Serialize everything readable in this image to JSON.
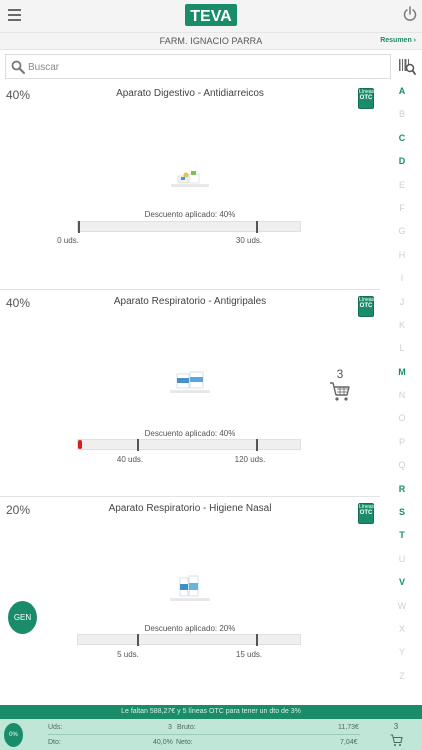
{
  "header": {
    "logo_text": "TEVA",
    "pharmacy_name": "FARM. IGNACIO PARRA",
    "summary_link": "Resumen ›"
  },
  "search": {
    "placeholder": "Buscar"
  },
  "alphabet": [
    {
      "letter": "A",
      "active": true
    },
    {
      "letter": "B",
      "active": false
    },
    {
      "letter": "C",
      "active": true
    },
    {
      "letter": "D",
      "active": true
    },
    {
      "letter": "E",
      "active": false
    },
    {
      "letter": "F",
      "active": false
    },
    {
      "letter": "G",
      "active": false
    },
    {
      "letter": "H",
      "active": false
    },
    {
      "letter": "I",
      "active": false
    },
    {
      "letter": "J",
      "active": false
    },
    {
      "letter": "K",
      "active": false
    },
    {
      "letter": "L",
      "active": false
    },
    {
      "letter": "M",
      "active": true
    },
    {
      "letter": "N",
      "active": false
    },
    {
      "letter": "O",
      "active": false
    },
    {
      "letter": "P",
      "active": false
    },
    {
      "letter": "Q",
      "active": false
    },
    {
      "letter": "R",
      "active": true
    },
    {
      "letter": "S",
      "active": true
    },
    {
      "letter": "T",
      "active": true
    },
    {
      "letter": "U",
      "active": false
    },
    {
      "letter": "V",
      "active": true
    },
    {
      "letter": "W",
      "active": false
    },
    {
      "letter": "X",
      "active": false
    },
    {
      "letter": "Y",
      "active": false
    },
    {
      "letter": "Z",
      "active": false
    }
  ],
  "cards": [
    {
      "discount_pct": "40%",
      "title": "Aparato Digestivo - Antidiarreicos",
      "badge_line1": "Líneas",
      "badge_line2": "OTC",
      "discount_applied": "Descuento aplicado: 40%",
      "tier1_label": "0 uds.",
      "tier2_label": "30 uds."
    },
    {
      "discount_pct": "40%",
      "title": "Aparato Respiratorio - Antigripales",
      "badge_line1": "Líneas",
      "badge_line2": "OTC",
      "discount_applied": "Descuento aplicado: 40%",
      "tier1_label": "40 uds.",
      "tier2_label": "120 uds.",
      "cart_count": "3"
    },
    {
      "discount_pct": "20%",
      "title": "Aparato Respiratorio - Higiene Nasal",
      "badge_line1": "Líneas",
      "badge_line2": "OTC",
      "discount_applied": "Descuento aplicado: 20%",
      "tier1_label": "5 uds.",
      "tier2_label": "15 uds."
    }
  ],
  "gen_button": "GEN",
  "footer": {
    "message": "Le faltan 588,27€ y 5 líneas OTC para tener un dto de 3%",
    "current_pct": "0%",
    "uds_label": "Uds:",
    "uds_value": "3",
    "bruto_label": "Bruto:",
    "bruto_value": "11,73€",
    "dto_label": "Dto:",
    "dto_value": "40,0%",
    "neto_label": "Neto:",
    "neto_value": "7,04€",
    "cart_count": "3"
  },
  "colors": {
    "brand": "#1a8c6a",
    "alert": "#d91c1c"
  }
}
